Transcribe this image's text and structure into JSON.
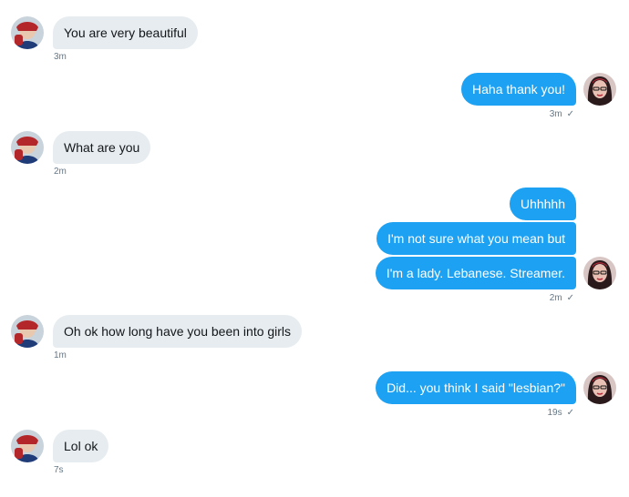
{
  "conversation": {
    "messages": [
      {
        "direction": "incoming",
        "text": "You are very beautiful",
        "time": "3m"
      },
      {
        "direction": "outgoing",
        "text": "Haha thank you!",
        "time": "3m",
        "receipt": "✓"
      },
      {
        "direction": "incoming",
        "text": "What are you",
        "time": "2m"
      },
      {
        "direction": "outgoing",
        "text": "Uhhhhh"
      },
      {
        "direction": "outgoing",
        "text": "I'm not sure what you mean but"
      },
      {
        "direction": "outgoing",
        "text": "I'm a lady. Lebanese. Streamer.",
        "time": "2m",
        "receipt": "✓"
      },
      {
        "direction": "incoming",
        "text": "Oh ok how long have you been into girls",
        "time": "1m"
      },
      {
        "direction": "outgoing",
        "text": "Did... you think I said \"lesbian?\"",
        "time": "19s",
        "receipt": "✓"
      },
      {
        "direction": "incoming",
        "text": "Lol ok",
        "time": "7s"
      }
    ]
  },
  "avatars": {
    "sender": {
      "icon": "superhero-avatar-icon",
      "colors": [
        "#b3262a",
        "#1f3c78",
        "#e9c8b0"
      ]
    },
    "me": {
      "icon": "woman-avatar-icon",
      "colors": [
        "#2a1a1c",
        "#b52a3a",
        "#e8c1b4"
      ]
    }
  },
  "theme": {
    "incoming_bg": "#e6ecf0",
    "outgoing_bg": "#1da1f2",
    "meta_color": "#657786"
  }
}
